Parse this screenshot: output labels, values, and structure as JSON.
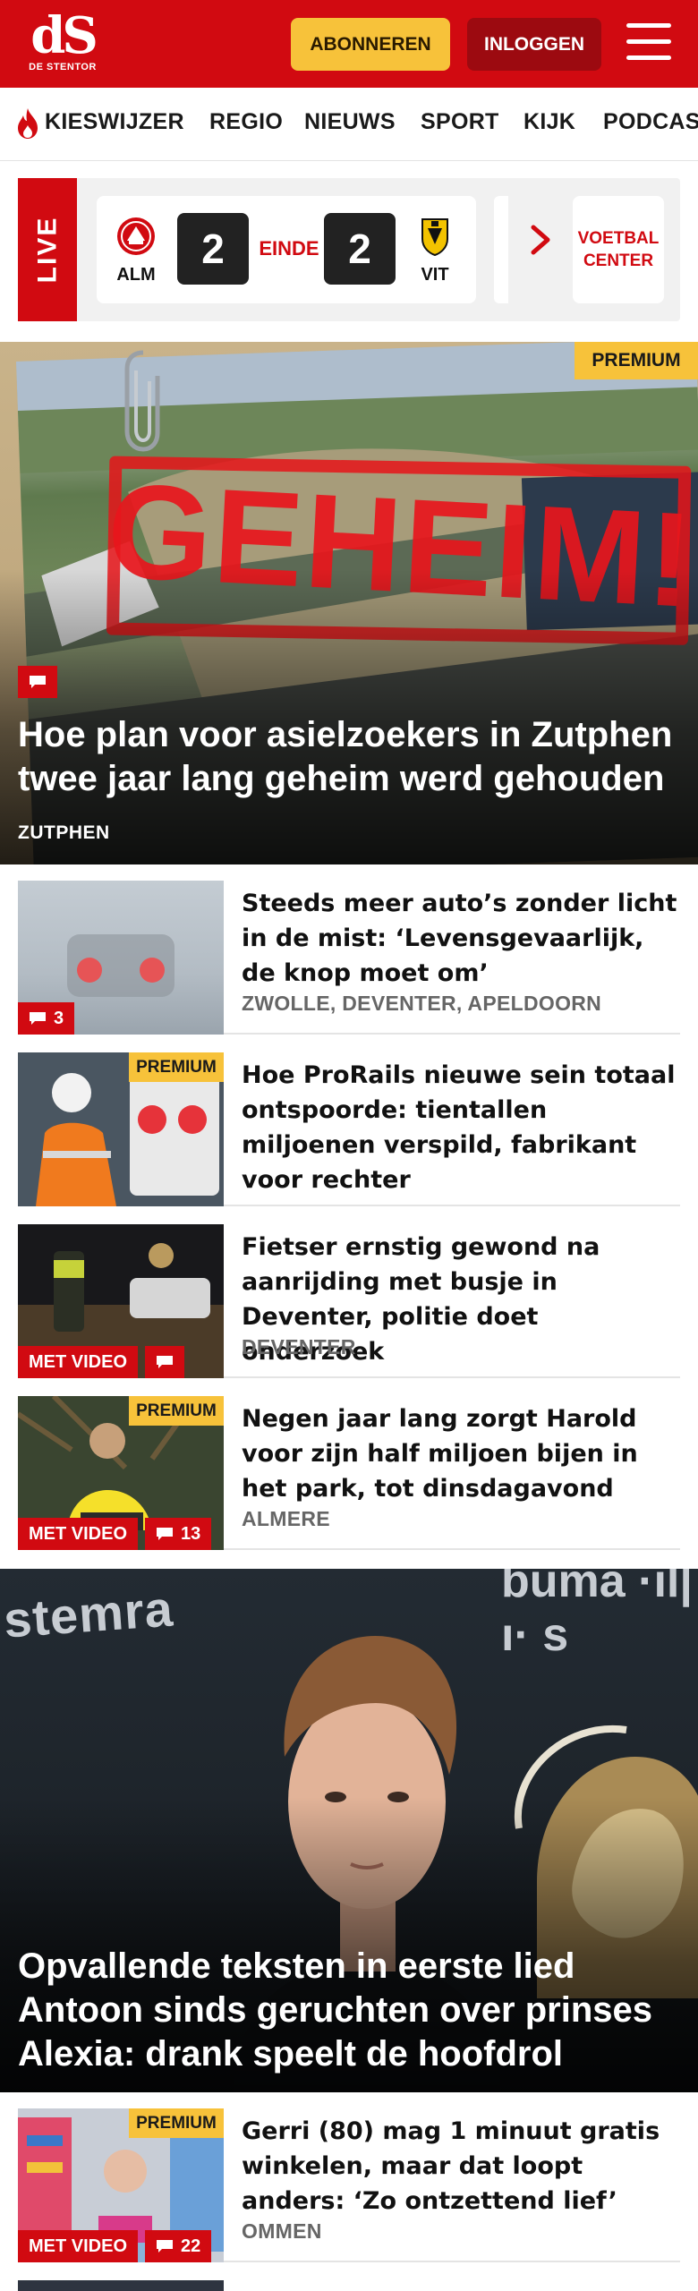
{
  "header": {
    "logo_text": "dS",
    "logo_sub": "DE STENTOR",
    "subscribe_label": "ABONNEREN",
    "login_label": "INLOGGEN",
    "colors": {
      "brand_red": "#d10a11",
      "accent_yellow": "#f7c23a",
      "dark_red": "#9c0a10"
    }
  },
  "nav": {
    "items": [
      "KIESWIJZER",
      "REGIO",
      "NIEUWS",
      "SPORT",
      "KIJK",
      "PODCAS"
    ]
  },
  "live": {
    "tag": "LIVE",
    "match": {
      "home": "ALM",
      "home_score": "2",
      "status": "EINDE",
      "away_score": "2",
      "away": "VIT"
    },
    "voetbal_center": "VOETBAL CENTER"
  },
  "hero1": {
    "badge": "PREMIUM",
    "stamp": "GEHEIM!",
    "title": "Hoe plan voor asielzoekers in Zutphen twee jaar lang geheim werd gehouden",
    "kicker": "ZUTPHEN"
  },
  "articles": [
    {
      "title": "Steeds meer auto’s zonder licht in de mist: ‘Levensgevaarlijk, de knop moet om’",
      "location": "ZWOLLE, DEVENTER, APELDOORN",
      "comments": "3"
    },
    {
      "premium": "PREMIUM",
      "title": "Hoe ProRails nieuwe sein totaal ontspoorde: tientallen miljoenen verspild, fabrikant voor rechter"
    },
    {
      "title": "Fietser ernstig gewond na aanrijding met busje in Deventer, politie doet onderzoek",
      "location": "DEVENTER",
      "video": "MET VIDEO"
    },
    {
      "premium": "PREMIUM",
      "title": "Negen jaar lang zorgt Harold voor zijn half miljoen bijen in het park, tot dinsdagavond",
      "location": "ALMERE",
      "video": "MET VIDEO",
      "comments": "13"
    }
  ],
  "hero2": {
    "backdrop_left": "stemra",
    "backdrop_right": "buma ·ıl|ı· s",
    "title": "Opvallende teksten in eerste lied Antoon sinds geruchten over prinses Alexia: drank speelt de hoofdrol"
  },
  "articles2": [
    {
      "premium": "PREMIUM",
      "title": "Gerri (80) mag 1 minuut gratis winkelen, maar dat loopt anders: ‘Zo ontzettend lief’",
      "location": "OMMEN",
      "video": "MET VIDEO",
      "comments": "22"
    }
  ]
}
